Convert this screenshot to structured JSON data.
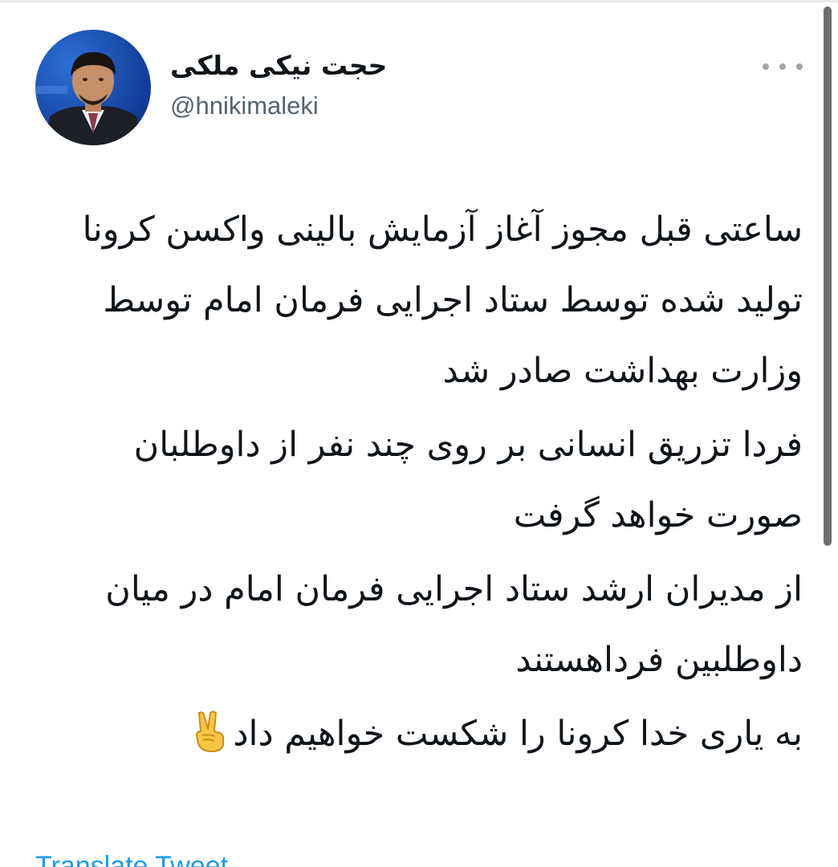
{
  "author": {
    "display_name": "حجت نیکی ملکی",
    "handle": "@hnikimaleki"
  },
  "tweet": {
    "paragraphs": [
      "ساعتی قبل مجوز آغاز آزمایش بالینی واکسن کرونا تولید شده توسط ستاد اجرایی فرمان امام توسط وزارت بهداشت صادر شد",
      "فردا تزریق انسانی بر روی چند نفر از داوطلبان صورت خواهد گرفت",
      "از مدیران ارشد ستاد اجرایی فرمان امام در میان داوطلبین فرداهستند",
      "به یاری خدا کرونا را شکست خواهیم داد"
    ],
    "closing_emoji_icon": "victory-hand-icon"
  },
  "actions": {
    "more_icon": "more-options-icon",
    "translate_label": "Translate Tweet"
  },
  "colors": {
    "text": "#0f1419",
    "secondary_text": "#536471",
    "link": "#1d9bf0"
  }
}
